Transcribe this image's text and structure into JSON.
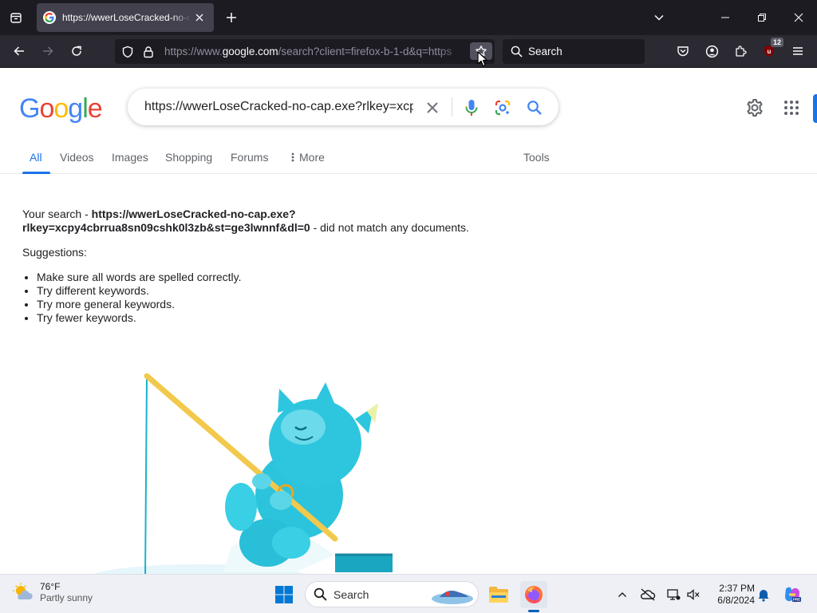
{
  "browser": {
    "tab_title": "https://wwerLoseCracked-no-c",
    "url_prefix": "https://www.",
    "url_domain": "google.com",
    "url_rest": "/search?client=firefox-b-1-d&q=https",
    "search_placeholder": "Search",
    "extension_badge": "12"
  },
  "google": {
    "logo_letters": [
      "G",
      "o",
      "o",
      "g",
      "l",
      "e"
    ],
    "logo_colors": [
      "#4285f4",
      "#ea4335",
      "#fbbc05",
      "#4285f4",
      "#34a853",
      "#ea4335"
    ],
    "query": "https://wwerLoseCracked-no-cap.exe?rlkey=xcp",
    "tabs": [
      "All",
      "Videos",
      "Images",
      "Shopping",
      "Forums",
      "More"
    ],
    "tools_label": "Tools",
    "your_search_prefix": "Your search - ",
    "your_search_query_line1": "https://wwerLoseCracked-no-cap.exe?",
    "your_search_query_line2": "rlkey=xcpy4cbrrua8sn09cshk0l3zb&st=ge3lwnnf&dl=0",
    "your_search_suffix": " - did not match any documents.",
    "suggestions_label": "Suggestions:",
    "suggestions": [
      "Make sure all words are spelled correctly.",
      "Try different keywords.",
      "Try more general keywords.",
      "Try fewer keywords."
    ]
  },
  "taskbar": {
    "weather_temp": "76°F",
    "weather_desc": "Partly sunny",
    "search_label": "Search",
    "time": "2:37 PM",
    "date": "6/8/2024"
  }
}
